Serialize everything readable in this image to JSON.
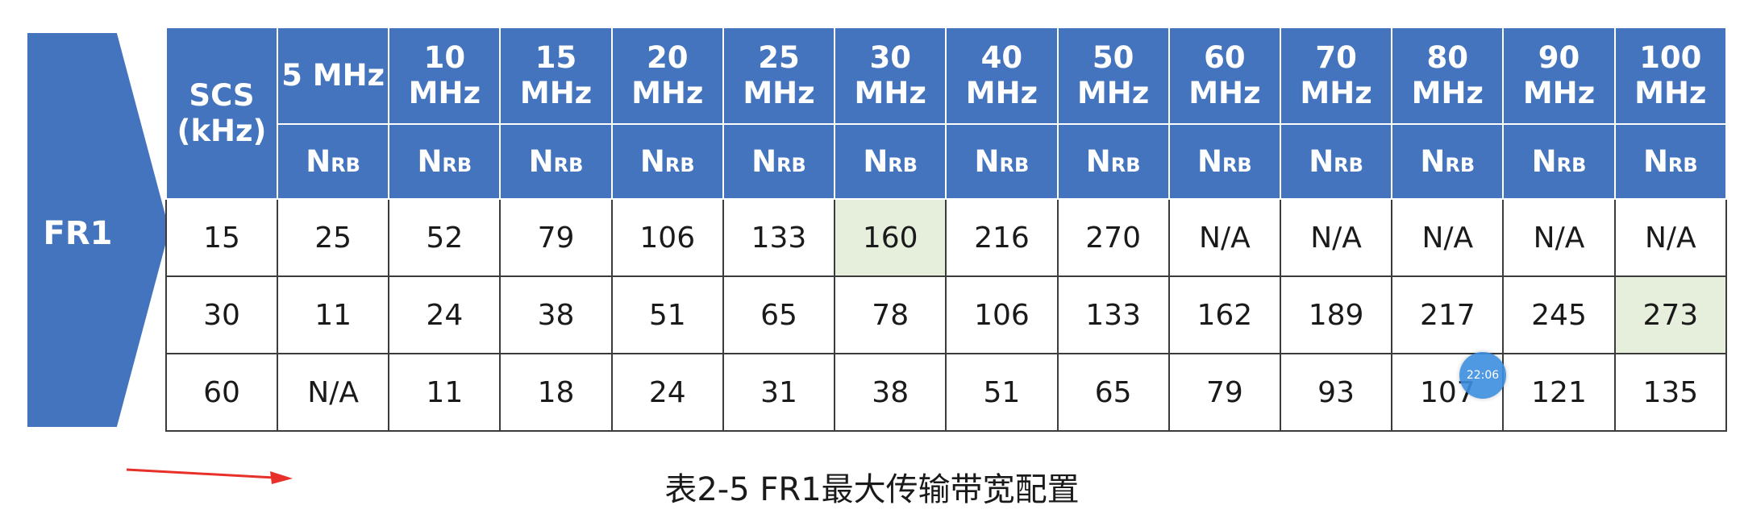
{
  "fr_label": "FR1",
  "header": {
    "scs_line1": "SCS",
    "scs_line2": "(kHz)",
    "bandwidths": [
      {
        "line1": "5 MHz",
        "line2": ""
      },
      {
        "line1": "10",
        "line2": "MHz"
      },
      {
        "line1": "15",
        "line2": "MHz"
      },
      {
        "line1": "20",
        "line2": "MHz"
      },
      {
        "line1": "25",
        "line2": "MHz"
      },
      {
        "line1": "30",
        "line2": "MHz"
      },
      {
        "line1": "40",
        "line2": "MHz"
      },
      {
        "line1": "50",
        "line2": "MHz"
      },
      {
        "line1": "60",
        "line2": "MHz"
      },
      {
        "line1": "70",
        "line2": "MHz"
      },
      {
        "line1": "80",
        "line2": "MHz"
      },
      {
        "line1": "90",
        "line2": "MHz"
      },
      {
        "line1": "100",
        "line2": "MHz"
      }
    ],
    "nrb_main": "N",
    "nrb_sub": "RB"
  },
  "rows": [
    {
      "scs": "15",
      "values": [
        "25",
        "52",
        "79",
        "106",
        "133",
        "160",
        "216",
        "270",
        "N/A",
        "N/A",
        "N/A",
        "N/A",
        "N/A"
      ],
      "highlight": [
        5
      ]
    },
    {
      "scs": "30",
      "values": [
        "11",
        "24",
        "38",
        "51",
        "65",
        "78",
        "106",
        "133",
        "162",
        "189",
        "217",
        "245",
        "273"
      ],
      "highlight": [
        12
      ]
    },
    {
      "scs": "60",
      "values": [
        "N/A",
        "11",
        "18",
        "24",
        "31",
        "38",
        "51",
        "65",
        "79",
        "93",
        "107",
        "121",
        "135"
      ],
      "highlight": []
    }
  ],
  "caption": "表2-5    FR1最大传输带宽配置",
  "time_badge": "22:06",
  "colors": {
    "header_blue": "#4474bd",
    "highlight_green": "#e5efdb",
    "arrow_red": "#e8302a"
  }
}
